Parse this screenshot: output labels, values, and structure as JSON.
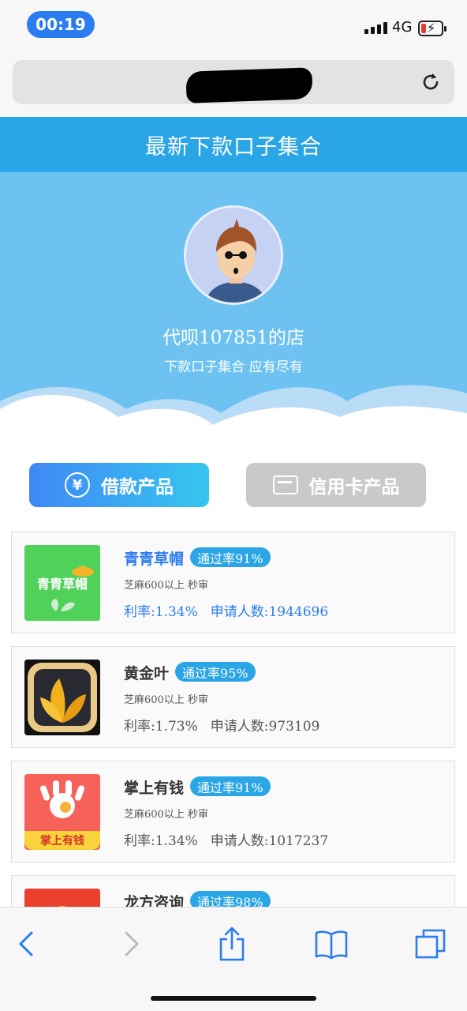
{
  "status": {
    "time": "00:19",
    "network": "4G"
  },
  "browser": {
    "reload_icon": "reload-icon"
  },
  "page": {
    "title": "最新下款口子集合"
  },
  "shop": {
    "name": "代呗107851的店",
    "subtitle": "下款口子集合 应有尽有"
  },
  "tabs": {
    "loan": "借款产品",
    "credit_card": "信用卡产品"
  },
  "products": [
    {
      "name": "青青草帽",
      "name_color": "#2b7cf0",
      "badge": "通过率91%",
      "requirement": "芝麻600以上 秒审",
      "rate": "利率:1.34%",
      "applicants": "申请人数:1944696",
      "stats_color": "#2b7cf0",
      "logo_text": "青青草帽"
    },
    {
      "name": "黄金叶",
      "name_color": "#333333",
      "badge": "通过率95%",
      "requirement": "芝麻600以上 秒审",
      "rate": "利率:1.73%",
      "applicants": "申请人数:973109",
      "stats_color": "#555555",
      "logo_text": ""
    },
    {
      "name": "掌上有钱",
      "name_color": "#333333",
      "badge": "通过率91%",
      "requirement": "芝麻600以上 秒审",
      "rate": "利率:1.34%",
      "applicants": "申请人数:1017237",
      "stats_color": "#555555",
      "logo_text": "掌上有钱"
    },
    {
      "name": "龙方咨询",
      "name_color": "#333333",
      "badge": "通过率98%",
      "requirement": "",
      "rate": "",
      "applicants": "",
      "stats_color": "#555555",
      "logo_text": ""
    }
  ],
  "colors": {
    "title_bar": "#2aa6e7",
    "hero": "#6ec2f1",
    "badge": "#2aa6e7",
    "accent": "#2b7cf0"
  }
}
